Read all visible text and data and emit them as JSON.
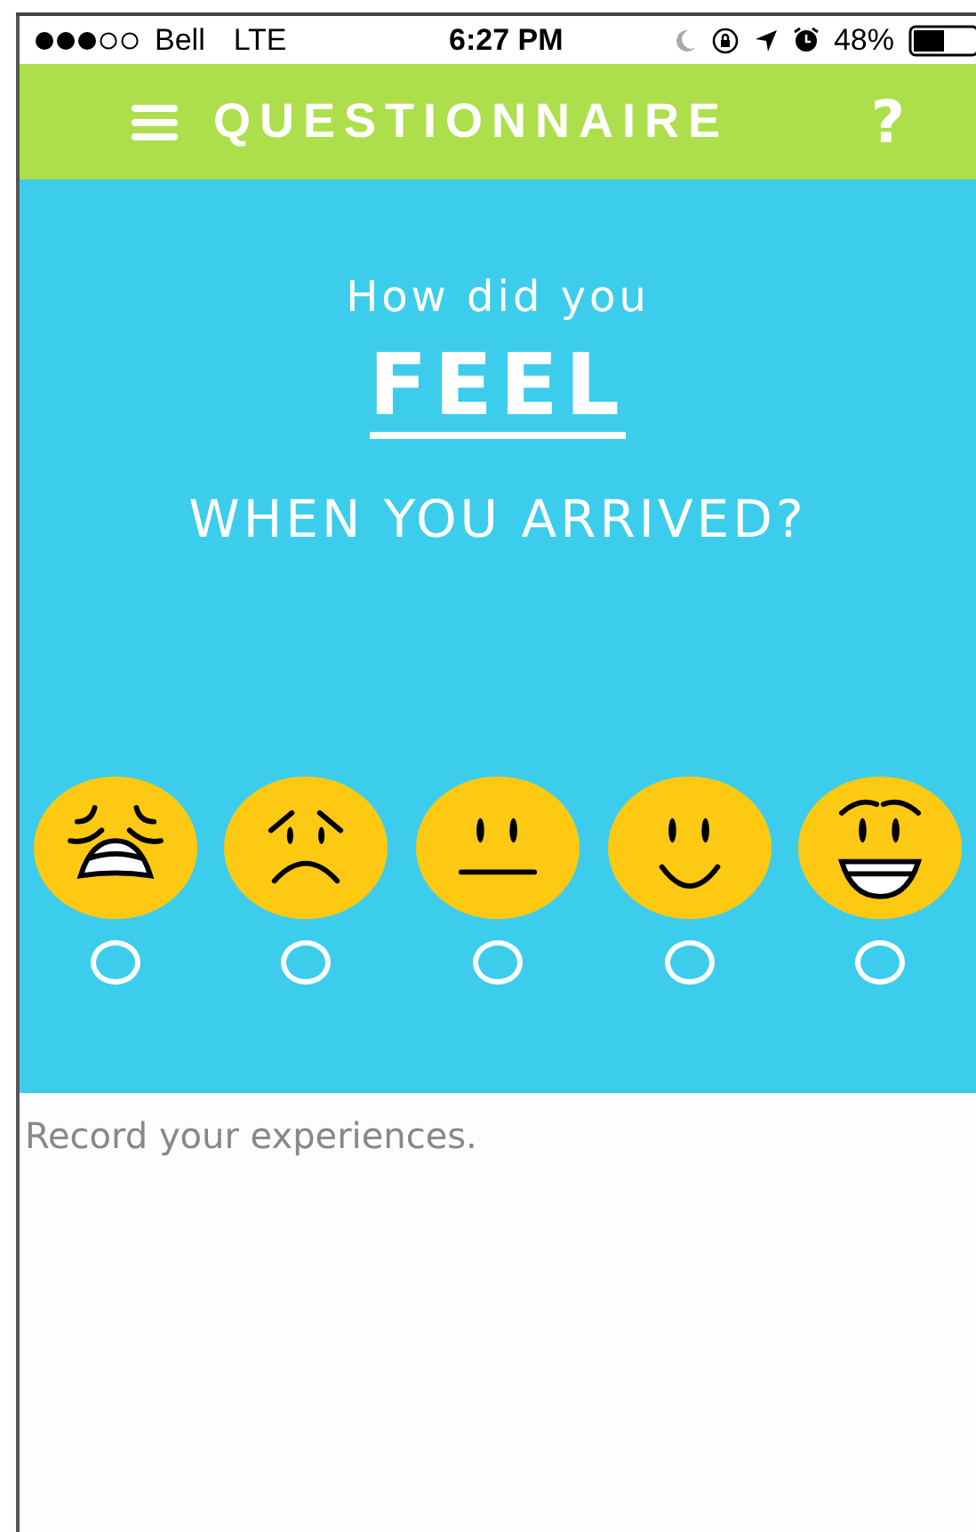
{
  "status_bar": {
    "carrier": "Bell",
    "network": "LTE",
    "time": "6:27 PM",
    "battery": "48%"
  },
  "header": {
    "title": "QUESTIONNAIRE",
    "help": "?"
  },
  "question": {
    "line_1": "How did you",
    "emphasis": "FEEL",
    "line_2": "WHEN YOU ARRIVED?"
  },
  "options": [
    {
      "kind": "weary",
      "selected": false
    },
    {
      "kind": "sad",
      "selected": false
    },
    {
      "kind": "neutral",
      "selected": false
    },
    {
      "kind": "smile",
      "selected": false
    },
    {
      "kind": "grin",
      "selected": false
    }
  ],
  "notes": {
    "placeholder": "Record your experiences."
  }
}
